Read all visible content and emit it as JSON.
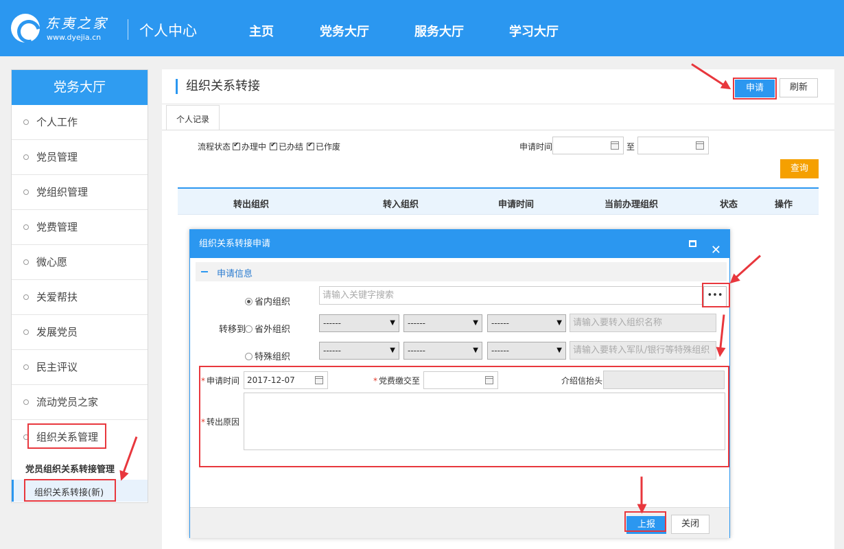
{
  "header": {
    "logo_cn": "东夷之家",
    "logo_en": "www.dyejia.cn",
    "title": "个人中心",
    "nav": [
      "主页",
      "党务大厅",
      "服务大厅",
      "学习大厅"
    ]
  },
  "sidebar": {
    "title": "党务大厅",
    "items": [
      "个人工作",
      "党员管理",
      "党组织管理",
      "党费管理",
      "微心愿",
      "关爱帮扶",
      "发展党员",
      "民主评议",
      "流动党员之家",
      "组织关系管理"
    ],
    "sub_title": "党员组织关系转接管理",
    "active_leaf": "组织关系转接(新)"
  },
  "main": {
    "title": "组织关系转接",
    "apply_label": "申请",
    "refresh_label": "刷新",
    "tab": "个人记录",
    "filter": {
      "status_label": "流程状态",
      "options": [
        "办理中",
        "已办结",
        "已作废"
      ],
      "time_label": "申请时间",
      "to_label": "至",
      "query_label": "查询"
    },
    "columns": [
      "转出组织",
      "转入组织",
      "申请时间",
      "当前办理组织",
      "状态",
      "操作"
    ]
  },
  "dialog": {
    "title": "组织关系转接申请",
    "section": "申请信息",
    "radio_in_province": "省内组织",
    "transfer_to": "转移到",
    "radio_out_province": "省外组织",
    "radio_special": "特殊组织",
    "search_placeholder": "请输入关键字搜索",
    "ellipsis": "•••",
    "select_default": "------",
    "out_org_placeholder": "请输入要转入组织名称",
    "special_placeholder": "请输入要转入军队/银行等特殊组织",
    "apply_time_label": "申请时间",
    "apply_time_value": "2017-12-07",
    "fee_paid_label": "党费缴交至",
    "intro_letter_label": "介绍信抬头",
    "reason_label": "转出原因",
    "submit_label": "上报",
    "close_label": "关闭"
  },
  "colors": {
    "primary": "#2b97f0",
    "query": "#f5a000",
    "highlight": "#e8373d"
  }
}
